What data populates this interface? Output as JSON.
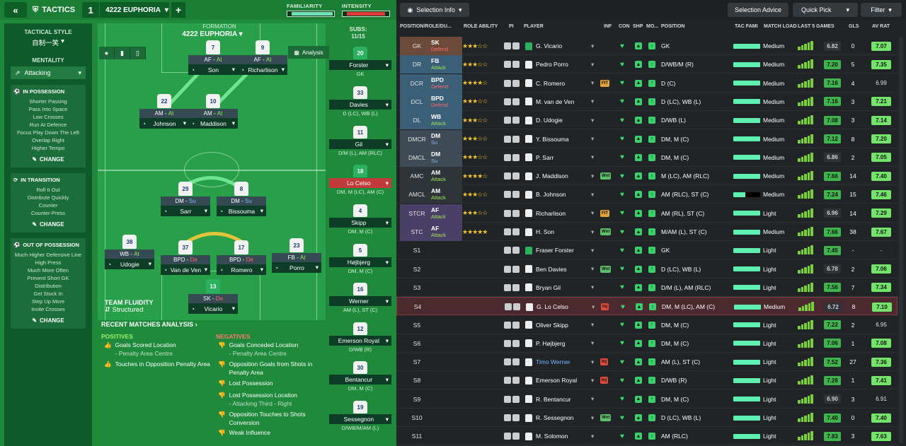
{
  "topbar": {
    "back": "«",
    "title": "TACTICS",
    "num": "1",
    "name": "4222 EUPHORIA",
    "plus": "+",
    "familiarity": "FAMILIARITY",
    "intensity": "INTENSITY"
  },
  "sidebar": {
    "tactical_style": "TACTICAL STYLE",
    "style_value": "自制一笑",
    "mentality": "MENTALITY",
    "mentality_value": "Attacking",
    "in_possession": {
      "title": "IN POSSESSION",
      "items": [
        "Shorter Passing",
        "Pass Into Space",
        "Low Crosses",
        "Run At Defence",
        "Focus Play Down The Left",
        "Overlap Right",
        "Higher Tempo"
      ]
    },
    "in_transition": {
      "title": "IN TRANSITION",
      "items": [
        "Roll It Out",
        "Distribute Quickly",
        "Counter",
        "Counter-Press"
      ]
    },
    "out_possession": {
      "title": "OUT OF POSSESSION",
      "items": [
        "Much Higher Defensive Line",
        "High Press",
        "Much More Often",
        "Prevent Short GK Distribution",
        "Get Stuck In",
        "Step Up More",
        "Invite Crosses"
      ]
    },
    "change": "CHANGE"
  },
  "formation": {
    "label": "FORMATION",
    "name": "4222 EUPHORIA",
    "analysis": "Analysis",
    "subs_label": "SUBS:",
    "subs_count": "11/15"
  },
  "pitch_players": [
    {
      "num": "7",
      "role": "AF",
      "duty": "At",
      "name": "Son"
    },
    {
      "num": "9",
      "role": "AF",
      "duty": "At",
      "name": "Richarlison"
    },
    {
      "num": "22",
      "role": "AM",
      "duty": "At",
      "name": "Johnson"
    },
    {
      "num": "10",
      "role": "AM",
      "duty": "At",
      "name": "Maddison"
    },
    {
      "num": "29",
      "role": "DM",
      "duty": "Su",
      "name": "Sarr"
    },
    {
      "num": "8",
      "role": "DM",
      "duty": "Su",
      "name": "Bissouma"
    },
    {
      "num": "38",
      "role": "WB",
      "duty": "At",
      "name": "Udogie"
    },
    {
      "num": "37",
      "role": "BPD",
      "duty": "De",
      "name": "Van de Ven"
    },
    {
      "num": "17",
      "role": "BPD",
      "duty": "De",
      "name": "Romero"
    },
    {
      "num": "23",
      "role": "FB",
      "duty": "At",
      "name": "Porro"
    },
    {
      "num": "13",
      "role": "SK",
      "duty": "De",
      "name": "Vicario"
    }
  ],
  "subs": [
    {
      "num": "20",
      "name": "Forster",
      "pos": "GK"
    },
    {
      "num": "33",
      "name": "Davies",
      "pos": "D (LC), WB (L)"
    },
    {
      "num": "11",
      "name": "Gil",
      "pos": "D/M (L), AM (RLC)"
    },
    {
      "num": "18",
      "name": "Lo Celso",
      "pos": "DM, M (LC), AM (C)"
    },
    {
      "num": "4",
      "name": "Skipp",
      "pos": "DM, M (C)"
    },
    {
      "num": "5",
      "name": "Højbjerg",
      "pos": "DM, M (C)"
    },
    {
      "num": "16",
      "name": "Werner",
      "pos": "AM (L), ST (C)"
    },
    {
      "num": "12",
      "name": "Emerson Royal",
      "pos": "D/WB (R)"
    },
    {
      "num": "30",
      "name": "Bentancur",
      "pos": "DM, M (C)"
    },
    {
      "num": "19",
      "name": "Sessegnon",
      "pos": "D/WB/M/AM (L)"
    }
  ],
  "fluidity": {
    "label": "TEAM FLUIDITY",
    "value": "Structured"
  },
  "recent": {
    "title": "RECENT MATCHES ANALYSIS",
    "positives_label": "POSITIVES",
    "negatives_label": "NEGATIVES",
    "positives": [
      {
        "a": "Goals Scored Location",
        "b": "- Penalty Area Centre"
      },
      {
        "a": "Touches in Opposition Penalty Area",
        "b": ""
      }
    ],
    "negatives": [
      {
        "a": "Goals Conceded Location",
        "b": "- Penalty Area Centre"
      },
      {
        "a": "Opposition Goals from Shots in Penalty Area",
        "b": ""
      },
      {
        "a": "Lost Possession",
        "b": ""
      },
      {
        "a": "Lost Possession Location",
        "b": "- Attacking Third - Right"
      },
      {
        "a": "Opposition Touches to Shots Conversion",
        "b": ""
      },
      {
        "a": "Weak Influence",
        "b": ""
      }
    ]
  },
  "right": {
    "selection_info": "Selection Info",
    "selection_advice": "Selection Advice",
    "quick_pick": "Quick Pick",
    "filter": "Filter",
    "headers": [
      "POSITION/ROLE/DU...",
      "ROLE ABILITY",
      "PI",
      "PLAYER",
      "INF",
      "CON",
      "SHP",
      "MO...",
      "POSITION",
      "TAC FAMI",
      "MATCH LOAD",
      "LAST 5 GAMES",
      "GLS",
      "AV RAT"
    ],
    "rows": [
      {
        "pos": "GK",
        "role": "SK",
        "duty": "Defend",
        "stars": "★★★☆☆",
        "player": "G. Vicario",
        "gk": true,
        "inf": "",
        "position": "GK",
        "load": "Medium",
        "r": "6.82",
        "gls": "0",
        "av": "7.07"
      },
      {
        "pos": "DR",
        "role": "FB",
        "duty": "Attack",
        "stars": "★★★☆☆",
        "player": "Pedro Porro",
        "inf": "",
        "position": "D/WB/M (R)",
        "load": "Medium",
        "r": "7.20",
        "gls": "5",
        "av": "7.35"
      },
      {
        "pos": "DCR",
        "role": "BPD",
        "duty": "Defend",
        "stars": "★★★★☆",
        "player": "C. Romero",
        "inf": "FIT",
        "position": "D (C)",
        "load": "Medium",
        "r": "7.16",
        "gls": "4",
        "av": "6.99"
      },
      {
        "pos": "DCL",
        "role": "BPD",
        "duty": "Defend",
        "stars": "★★★☆☆",
        "player": "M. van de Ven",
        "inf": "",
        "position": "D (LC), WB (L)",
        "load": "Medium",
        "r": "7.16",
        "gls": "3",
        "av": "7.21"
      },
      {
        "pos": "DL",
        "role": "WB",
        "duty": "Attack",
        "stars": "★★★☆☆",
        "player": "D. Udogie",
        "inf": "",
        "position": "D/WB (L)",
        "load": "Medium",
        "r": "7.08",
        "gls": "3",
        "av": "7.14"
      },
      {
        "pos": "DMCR",
        "role": "DM",
        "duty": "Su",
        "stars": "★★★☆☆",
        "player": "Y. Bissouma",
        "inf": "",
        "position": "DM, M (C)",
        "load": "Medium",
        "r": "7.12",
        "gls": "8",
        "av": "7.20"
      },
      {
        "pos": "DMCL",
        "role": "DM",
        "duty": "Su",
        "stars": "★★★☆☆",
        "player": "P. Sarr",
        "inf": "",
        "position": "DM, M (C)",
        "load": "Medium",
        "r": "6.86",
        "gls": "2",
        "av": "7.05"
      },
      {
        "pos": "AMC",
        "role": "AM",
        "duty": "Attack",
        "stars": "★★★★☆",
        "player": "J. Maddison",
        "inf": "Wnt",
        "position": "M (LC), AM (RLC)",
        "load": "Medium",
        "r": "7.66",
        "gls": "14",
        "av": "7.40"
      },
      {
        "pos": "AMCL",
        "role": "AM",
        "duty": "Attack",
        "stars": "★★★☆☆",
        "player": "B. Johnson",
        "inf": "",
        "position": "AM (RLC), ST (C)",
        "load": "Medium",
        "r": "7.24",
        "gls": "15",
        "av": "7.46"
      },
      {
        "pos": "STCR",
        "role": "AF",
        "duty": "Attack",
        "stars": "★★★☆☆",
        "player": "Richarlison",
        "inf": "FIT",
        "position": "AM (RL), ST (C)",
        "load": "Light",
        "r": "6.96",
        "gls": "14",
        "av": "7.29"
      },
      {
        "pos": "STC",
        "role": "AF",
        "duty": "Attack",
        "stars": "★★★★★",
        "player": "H. Son",
        "inf": "Wnt",
        "position": "M/AM (L), ST (C)",
        "load": "Medium",
        "r": "7.66",
        "gls": "38",
        "av": "7.67"
      },
      {
        "pos": "S1",
        "role": "",
        "duty": "",
        "stars": "",
        "player": "Fraser Forster",
        "gk": true,
        "inf": "",
        "position": "GK",
        "load": "Light",
        "r": "7.45",
        "gls": "-",
        "av": "-"
      },
      {
        "pos": "S2",
        "role": "",
        "duty": "",
        "stars": "",
        "player": "Ben Davies",
        "inf": "Wnt",
        "position": "D (LC), WB (L)",
        "load": "Light",
        "r": "6.78",
        "gls": "2",
        "av": "7.06"
      },
      {
        "pos": "S3",
        "role": "",
        "duty": "",
        "stars": "",
        "player": "Bryan Gil",
        "inf": "",
        "position": "D/M (L), AM (RLC)",
        "load": "Light",
        "r": "7.56",
        "gls": "7",
        "av": "7.34"
      },
      {
        "pos": "S4",
        "role": "",
        "duty": "",
        "stars": "",
        "player": "G. Lo Celso",
        "inf": "Inj",
        "position": "DM, M (LC), AM (C)",
        "load": "Medium",
        "r": "6.72",
        "gls": "8",
        "av": "7.10",
        "sel": true
      },
      {
        "pos": "S5",
        "role": "",
        "duty": "",
        "stars": "",
        "player": "Oliver Skipp",
        "inf": "",
        "position": "DM, M (C)",
        "load": "Light",
        "r": "7.22",
        "gls": "2",
        "av": "6.95"
      },
      {
        "pos": "S6",
        "role": "",
        "duty": "",
        "stars": "",
        "player": "P. Højbjerg",
        "inf": "",
        "position": "DM, M (C)",
        "load": "Light",
        "r": "7.06",
        "gls": "1",
        "av": "7.08"
      },
      {
        "pos": "S7",
        "role": "",
        "duty": "",
        "stars": "",
        "player": "Timo Werner",
        "inf": "Inj",
        "position": "AM (L), ST (C)",
        "load": "Light",
        "r": "7.52",
        "gls": "27",
        "av": "7.36"
      },
      {
        "pos": "S8",
        "role": "",
        "duty": "",
        "stars": "",
        "player": "Emerson Royal",
        "inf": "Inj",
        "position": "D/WB (R)",
        "load": "Light",
        "r": "7.28",
        "gls": "1",
        "av": "7.41"
      },
      {
        "pos": "S9",
        "role": "",
        "duty": "",
        "stars": "",
        "player": "R. Bentancur",
        "inf": "",
        "position": "DM, M (C)",
        "load": "Light",
        "r": "6.90",
        "gls": "3",
        "av": "6.91"
      },
      {
        "pos": "S10",
        "role": "",
        "duty": "",
        "stars": "",
        "player": "R. Sessegnon",
        "inf": "Wnt",
        "position": "D (LC), WB (L)",
        "load": "Light",
        "r": "7.40",
        "gls": "0",
        "av": "7.40"
      },
      {
        "pos": "S11",
        "role": "",
        "duty": "",
        "stars": "",
        "player": "M. Solomon",
        "inf": "",
        "position": "AM (RLC)",
        "load": "Light",
        "r": "7.83",
        "gls": "3",
        "av": "7.63"
      }
    ]
  }
}
